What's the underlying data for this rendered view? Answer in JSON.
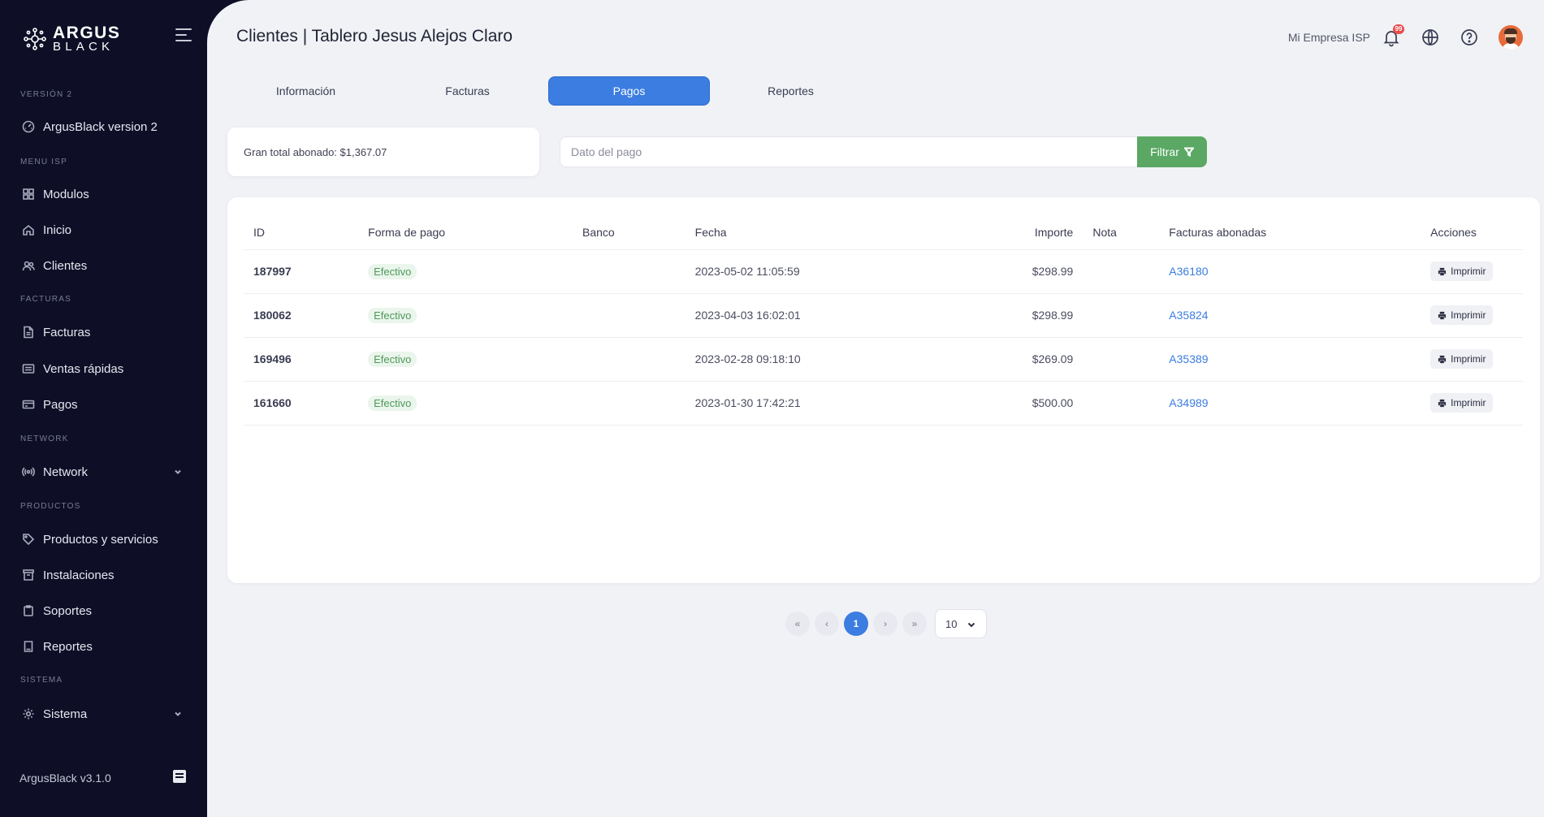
{
  "brand": {
    "line1": "ARGUS",
    "line2": "BLACK"
  },
  "sidebar": {
    "sections": [
      {
        "label": "VERSIÓN 2"
      },
      {
        "label": "MENU ISP"
      },
      {
        "label": "FACTURAS"
      },
      {
        "label": "NETWORK"
      },
      {
        "label": "PRODUCTOS"
      },
      {
        "label": "SISTEMA"
      }
    ],
    "items": [
      {
        "label": "ArgusBlack version 2",
        "icon": "gauge-icon"
      },
      {
        "label": "Modulos",
        "icon": "grid-icon"
      },
      {
        "label": "Inicio",
        "icon": "home-icon"
      },
      {
        "label": "Clientes",
        "icon": "users-icon"
      },
      {
        "label": "Facturas",
        "icon": "file-icon"
      },
      {
        "label": "Ventas rápidas",
        "icon": "list-icon"
      },
      {
        "label": "Pagos",
        "icon": "card-icon"
      },
      {
        "label": "Network",
        "icon": "broadcast-icon"
      },
      {
        "label": "Productos y servicios",
        "icon": "tag-icon"
      },
      {
        "label": "Instalaciones",
        "icon": "archive-icon"
      },
      {
        "label": "Soportes",
        "icon": "clipboard-icon"
      },
      {
        "label": "Reportes",
        "icon": "book-icon"
      },
      {
        "label": "Sistema",
        "icon": "gear-icon"
      }
    ],
    "version": "ArgusBlack v3.1.0"
  },
  "header": {
    "title": "Clientes | Tablero Jesus Alejos Claro",
    "company": "Mi Empresa ISP",
    "notifications_count": "99"
  },
  "tabs": [
    {
      "label": "Información"
    },
    {
      "label": "Facturas"
    },
    {
      "label": "Pagos",
      "active": true
    },
    {
      "label": "Reportes"
    }
  ],
  "summary": {
    "total_label": "Gran total abonado: $1,367.07"
  },
  "filter": {
    "placeholder": "Dato del pago",
    "value": "",
    "button_label": "Filtrar"
  },
  "table": {
    "headers": {
      "id": "ID",
      "forma": "Forma de pago",
      "banco": "Banco",
      "fecha": "Fecha",
      "importe": "Importe",
      "nota": "Nota",
      "facturas": "Facturas abonadas",
      "acciones": "Acciones"
    },
    "rows": [
      {
        "id": "187997",
        "forma": "Efectivo",
        "banco": "",
        "fecha": "2023-05-02 11:05:59",
        "importe": "$298.99",
        "nota": "",
        "factura": "A36180",
        "accion": "Imprimir"
      },
      {
        "id": "180062",
        "forma": "Efectivo",
        "banco": "",
        "fecha": "2023-04-03 16:02:01",
        "importe": "$298.99",
        "nota": "",
        "factura": "A35824",
        "accion": "Imprimir"
      },
      {
        "id": "169496",
        "forma": "Efectivo",
        "banco": "",
        "fecha": "2023-02-28 09:18:10",
        "importe": "$269.09",
        "nota": "",
        "factura": "A35389",
        "accion": "Imprimir"
      },
      {
        "id": "161660",
        "forma": "Efectivo",
        "banco": "",
        "fecha": "2023-01-30 17:42:21",
        "importe": "$500.00",
        "nota": "",
        "factura": "A34989",
        "accion": "Imprimir"
      }
    ]
  },
  "pagination": {
    "first": "«",
    "prev": "‹",
    "current": "1",
    "next": "›",
    "last": "»",
    "per_page": "10"
  },
  "colors": {
    "sidebar_bg": "#0e0f27",
    "main_bg": "#f0f2f6",
    "accent": "#3b7de0",
    "filter_button": "#5aa863",
    "pill_text": "#4f9a5a",
    "badge": "#e94c4c"
  }
}
